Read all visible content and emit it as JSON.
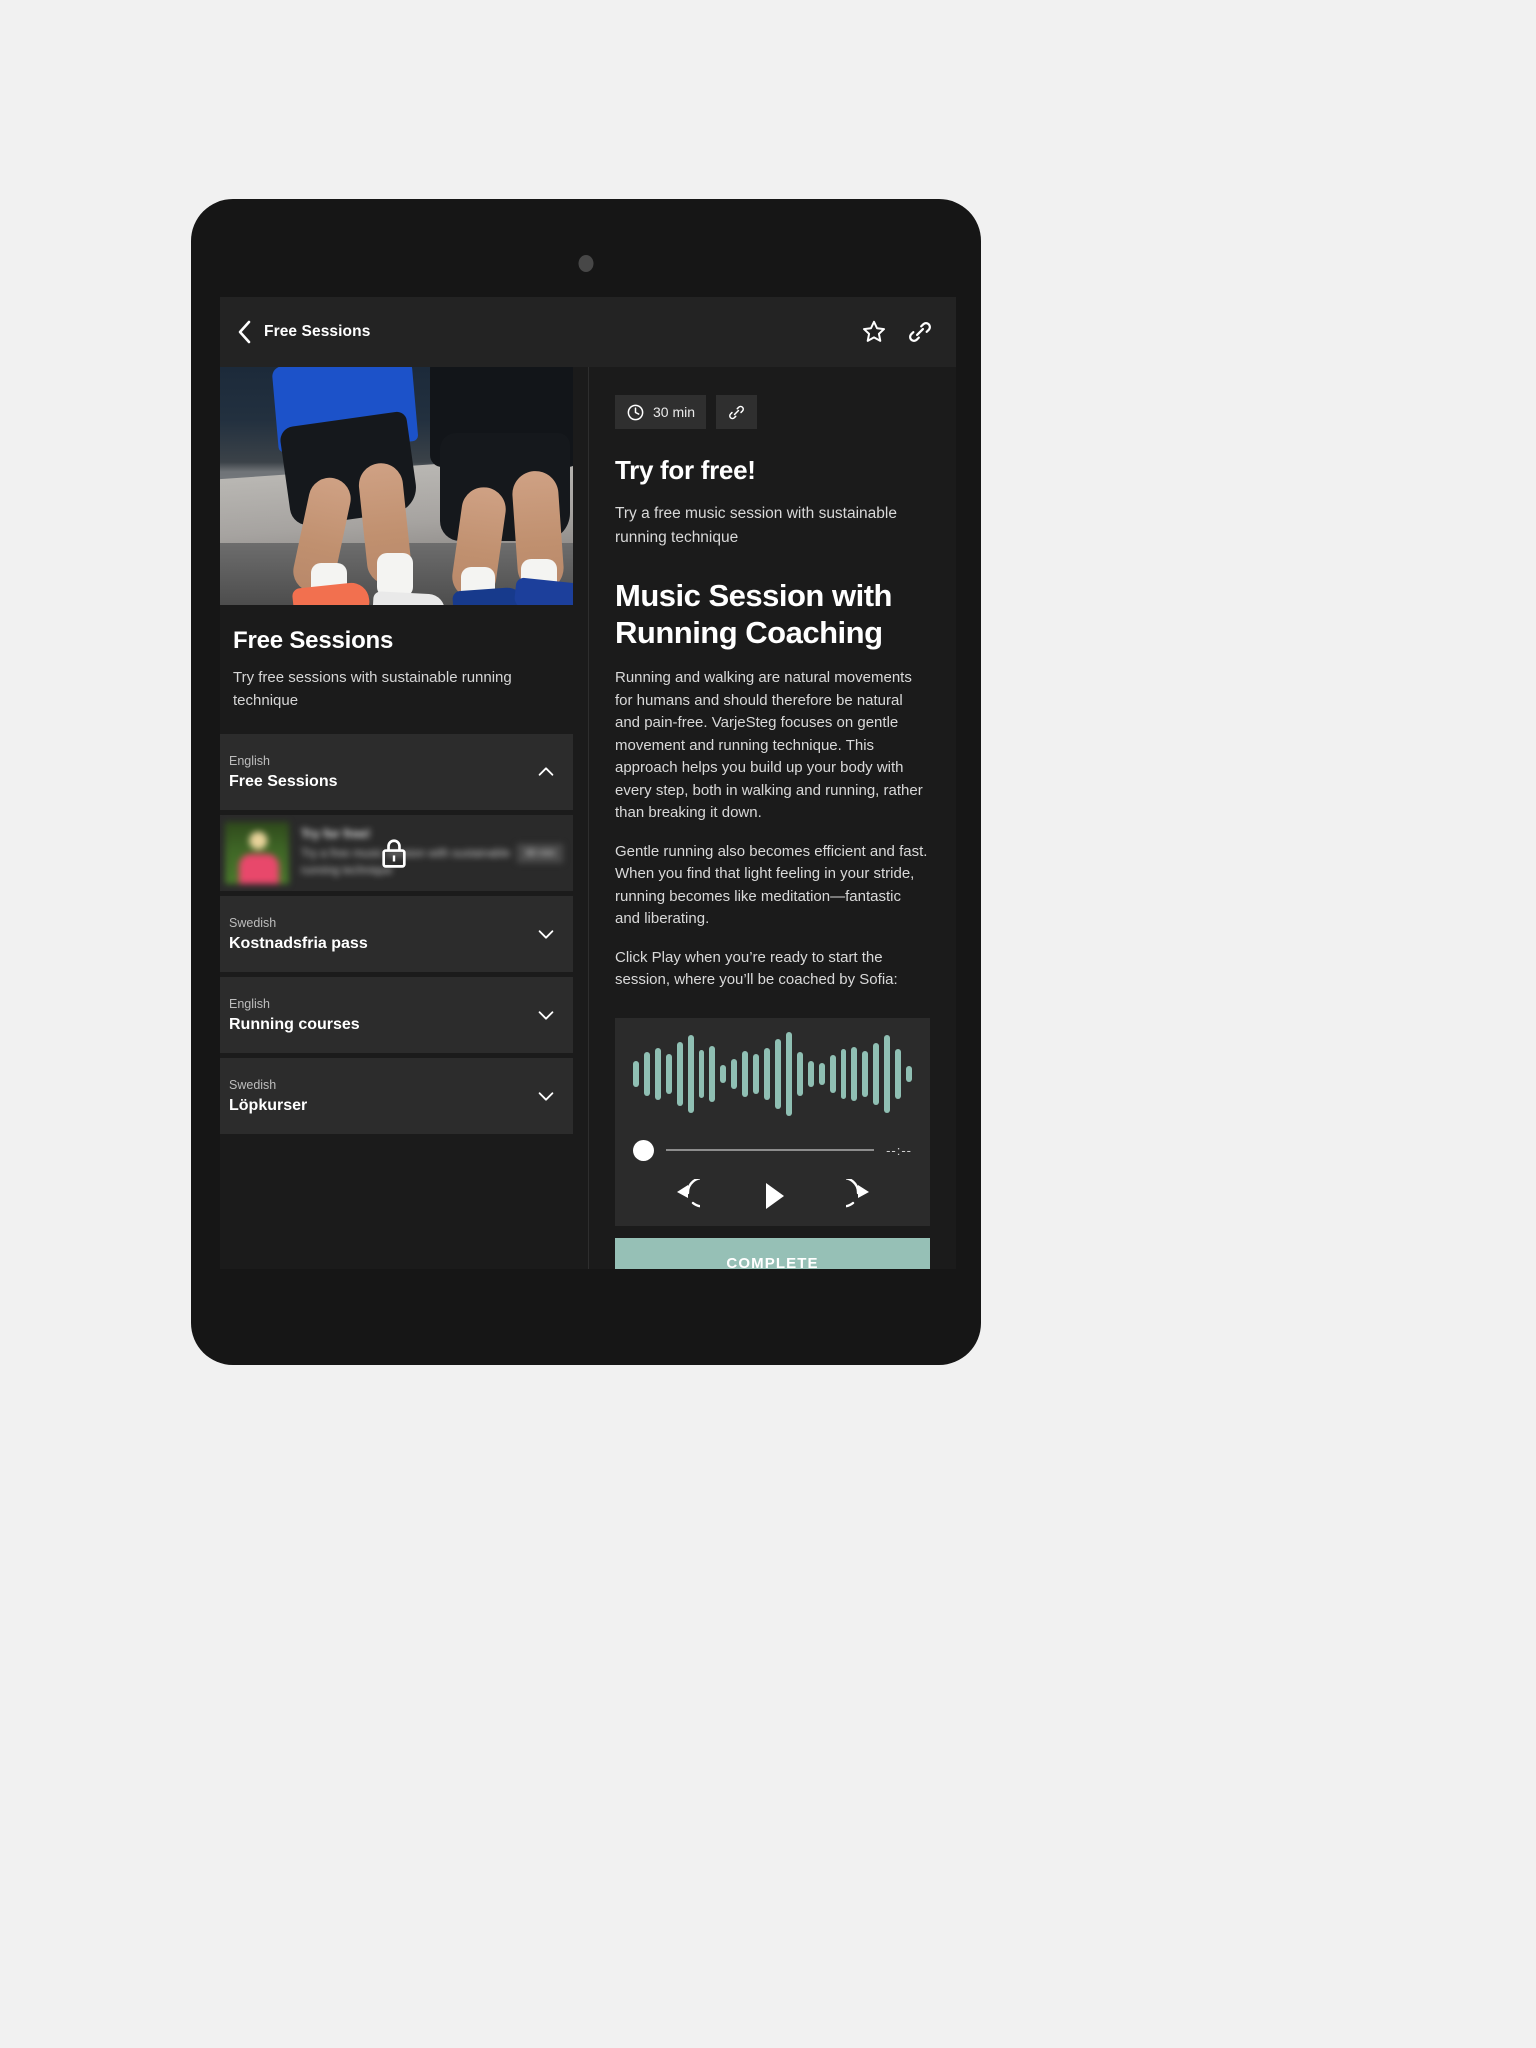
{
  "appbar": {
    "title": "Free Sessions",
    "back_icon": "chevron-left-icon",
    "favorite_icon": "star-outline-icon",
    "share_icon": "link-icon"
  },
  "left_panel": {
    "hero_alt": "two-runners-photo",
    "title": "Free Sessions",
    "subtitle": "Try free sessions with sustainable running technique",
    "accordions": [
      {
        "language": "English",
        "name": "Free Sessions",
        "state": "expanded",
        "chevron": "chevron-up-icon"
      },
      {
        "language": "Swedish",
        "name": "Kostnadsfria pass",
        "state": "collapsed",
        "chevron": "chevron-down-icon"
      },
      {
        "language": "English",
        "name": "Running courses",
        "state": "collapsed",
        "chevron": "chevron-down-icon"
      },
      {
        "language": "Swedish",
        "name": "Löpkurser",
        "state": "collapsed",
        "chevron": "chevron-down-icon"
      }
    ],
    "locked_session": {
      "title": "Try for free!",
      "description": "Try a free music session with sustainable running technique",
      "duration": "30 min",
      "lock_icon": "lock-icon",
      "locked": true
    }
  },
  "right_panel": {
    "duration_badge": "30 min",
    "duration_icon": "clock-icon",
    "share_icon": "link-icon",
    "heading": "Try for free!",
    "subheading": "Try a free music session with sustainable running technique",
    "title": "Music Session with Running Coaching",
    "paragraphs": [
      "Running and walking are natural movements for humans and should therefore be natural and pain-free. VarjeSteg focuses on gentle movement and running technique. This approach helps you build up your body with every step, both in walking and running, rather than breaking it down.",
      "Gentle running also becomes efficient and fast. When you find that light feeling in your stride, running becomes like meditation—fantastic and liberating.",
      "Click Play when you’re ready to start the session, where you’ll be coached by Sofia:"
    ],
    "player": {
      "time_remaining": "--:--",
      "progress_percent": 0,
      "rewind_icon": "rewind-15-icon",
      "play_icon": "play-icon",
      "forward_icon": "forward-15-icon",
      "waveform_color": "#8fbfb3",
      "waveform_heights": [
        26,
        44,
        52,
        40,
        64,
        78,
        48,
        56,
        18,
        30,
        46,
        40,
        52,
        70,
        84,
        44,
        26,
        22,
        38,
        50,
        54,
        46,
        62,
        78,
        50,
        16
      ]
    },
    "complete_button": "COMPLETE"
  },
  "colors": {
    "accent": "#96c0b6",
    "screen_bg": "#1b1b1b",
    "appbar_bg": "#232323",
    "card_bg": "#2c2c2c"
  }
}
